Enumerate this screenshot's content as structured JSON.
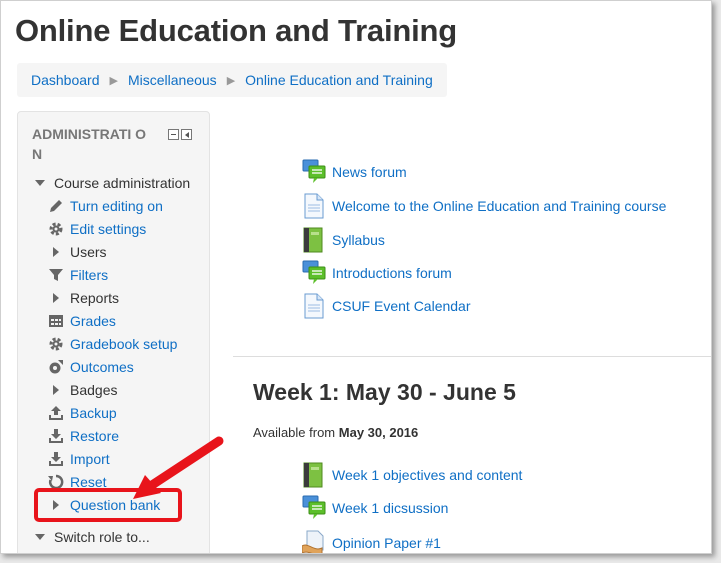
{
  "page": {
    "title": "Online Education and Training"
  },
  "breadcrumb": [
    {
      "label": "Dashboard"
    },
    {
      "label": "Miscellaneous"
    },
    {
      "label": "Online Education and Training"
    }
  ],
  "admin": {
    "title": "ADMINISTRATION",
    "title_wrapped": "ADMINISTRATI ON",
    "items": [
      {
        "label": "Course administration",
        "icon": "triangle-down-icon",
        "link": false
      },
      {
        "label": "Turn editing on",
        "icon": "pencil-icon",
        "link": true
      },
      {
        "label": "Edit settings",
        "icon": "gear-icon",
        "link": true
      },
      {
        "label": "Users",
        "icon": "triangle-right-icon",
        "link": false
      },
      {
        "label": "Filters",
        "icon": "filter-icon",
        "link": true
      },
      {
        "label": "Reports",
        "icon": "triangle-right-icon",
        "link": false
      },
      {
        "label": "Grades",
        "icon": "grades-table-icon",
        "link": true
      },
      {
        "label": "Gradebook setup",
        "icon": "gear-icon",
        "link": true
      },
      {
        "label": "Outcomes",
        "icon": "outcomes-icon",
        "link": true
      },
      {
        "label": "Badges",
        "icon": "triangle-right-icon",
        "link": false
      },
      {
        "label": "Backup",
        "icon": "upload-icon",
        "link": true
      },
      {
        "label": "Restore",
        "icon": "download-icon",
        "link": true
      },
      {
        "label": "Import",
        "icon": "download-icon",
        "link": true
      },
      {
        "label": "Reset",
        "icon": "reset-icon",
        "link": true
      },
      {
        "label": "Question bank",
        "icon": "triangle-right-icon",
        "link": true
      },
      {
        "label": "Switch role to...",
        "icon": "triangle-down-icon",
        "link": false
      }
    ]
  },
  "section0": {
    "activities": [
      {
        "label": "News forum",
        "icon": "forum-icon"
      },
      {
        "label": "Welcome to the Online Education and Training course",
        "icon": "page-icon"
      },
      {
        "label": "Syllabus",
        "icon": "book-icon"
      },
      {
        "label": "Introductions forum",
        "icon": "forum-icon"
      },
      {
        "label": "CSUF Event Calendar",
        "icon": "page-icon"
      }
    ]
  },
  "week1": {
    "title": "Week 1: May 30 - June 5",
    "available_prefix": "Available from",
    "available_date": "May 30, 2016",
    "activities": [
      {
        "label": "Week 1 objectives and content",
        "icon": "book-icon"
      },
      {
        "label": "Week 1 dicsussion",
        "icon": "forum-icon"
      },
      {
        "label": "Opinion Paper #1",
        "icon": "assignment-icon"
      }
    ]
  },
  "colors": {
    "link": "#0f6fc5",
    "highlight": "#e8141b",
    "forum_green": "#5cbf2a",
    "book_green": "#7dc142"
  }
}
